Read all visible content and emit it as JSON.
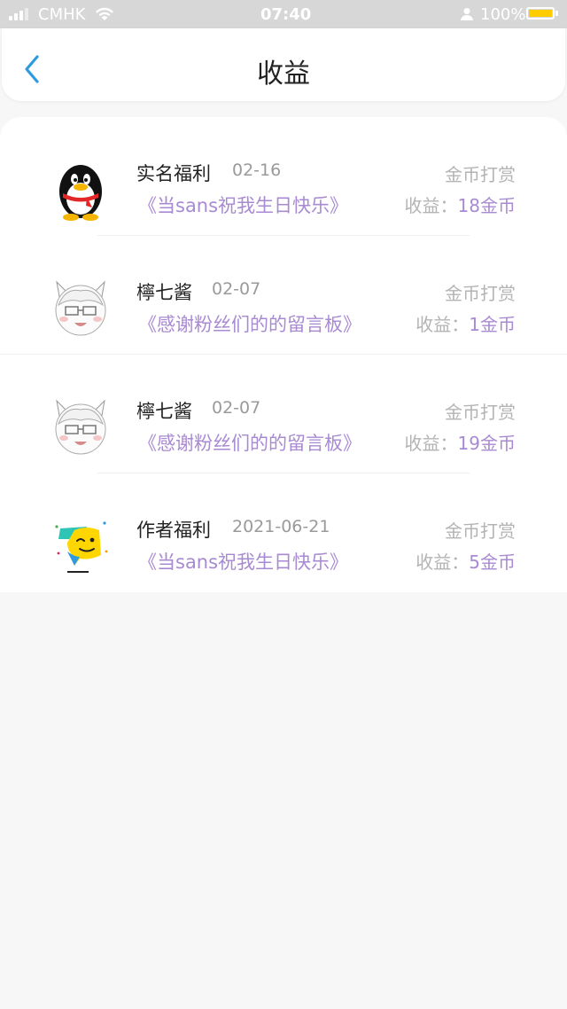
{
  "status_bar": {
    "carrier": "CMHK",
    "time": "07:40",
    "battery": "100%"
  },
  "header": {
    "title": "收益"
  },
  "items": [
    {
      "name": "实名福利",
      "date": "02-16",
      "work": "《当sans祝我生日快乐》",
      "type": "金币打赏",
      "earn_label": "收益：",
      "earn_value": "18金币",
      "avatar": "qq-penguin-avatar"
    },
    {
      "name": "檸七酱",
      "date": "02-07",
      "work": "《感谢粉丝们的的留言板》",
      "type": "金币打赏",
      "earn_label": "收益：",
      "earn_value": "1金币",
      "avatar": "cat-boy-avatar"
    },
    {
      "name": "檸七酱",
      "date": "02-07",
      "work": "《感谢粉丝们的的留言板》",
      "type": "金币打赏",
      "earn_label": "收益：",
      "earn_value": "19金币",
      "avatar": "cat-boy-avatar"
    },
    {
      "name": "作者福利",
      "date": "2021-06-21",
      "work": "《当sans祝我生日快乐》",
      "type": "金币打赏",
      "earn_label": "收益：",
      "earn_value": "5金币",
      "avatar": "chat-bubble-avatar"
    }
  ],
  "colors": {
    "accent": "#a88ad2",
    "back_arrow": "#2f9bdf",
    "muted": "#b3b3b3"
  }
}
